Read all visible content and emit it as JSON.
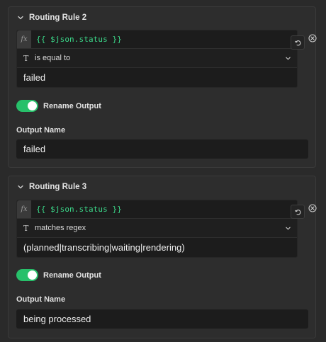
{
  "rules": [
    {
      "title": "Routing Rule 2",
      "expression": "{{ $json.status }}",
      "fx_label": "fx",
      "operator": "is equal to",
      "value": "failed",
      "rename_label": "Rename Output",
      "rename_enabled": true,
      "output_name_label": "Output Name",
      "output_name": "failed"
    },
    {
      "title": "Routing Rule 3",
      "expression": "{{ $json.status }}",
      "fx_label": "fx",
      "operator": "matches regex",
      "value": "(planned|transcribing|waiting|rendering)",
      "rename_label": "Rename Output",
      "rename_enabled": true,
      "output_name_label": "Output Name",
      "output_name": "being processed"
    }
  ],
  "icons": {
    "collapse": "chevron-down-icon",
    "type": "text-type-icon",
    "dropdown": "chevron-down-icon",
    "undo": "undo-icon",
    "delete": "close-circle-icon"
  },
  "colors": {
    "toggle_on": "#27c06a",
    "expression": "#3bd98a"
  }
}
